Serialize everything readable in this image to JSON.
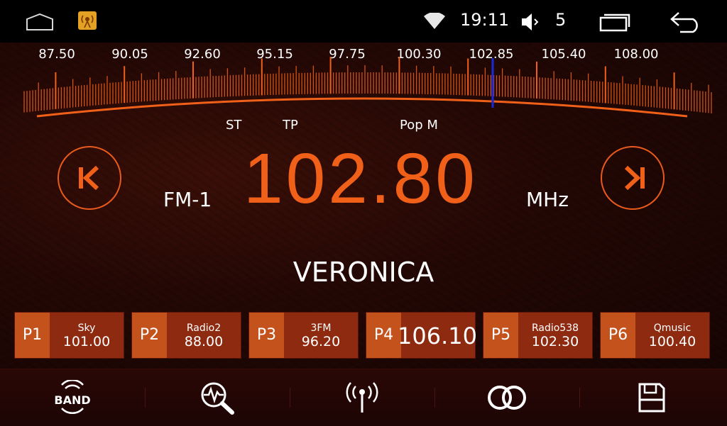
{
  "status_bar": {
    "time": "19:11",
    "volume_level": "5",
    "icons": [
      "home-icon",
      "radio-app-icon",
      "wifi-icon",
      "speaker-icon",
      "recent-apps-icon",
      "back-icon"
    ]
  },
  "dial": {
    "scale": [
      "87.50",
      "90.05",
      "92.60",
      "95.15",
      "97.75",
      "100.30",
      "102.85",
      "105.40",
      "108.00"
    ],
    "accent_color": "#f06018",
    "needle_color": "#1a2ad8"
  },
  "indicators": {
    "st": "ST",
    "tp": "TP",
    "pty": "Pop M"
  },
  "tuner": {
    "band": "FM-1",
    "frequency": "102.80",
    "unit": "MHz",
    "station_name": "VERONICA",
    "prev_icon": "seek-back-icon",
    "next_icon": "seek-forward-icon"
  },
  "presets": [
    {
      "num": "P1",
      "name": "Sky",
      "freq": "101.00"
    },
    {
      "num": "P2",
      "name": "Radio2",
      "freq": "88.00"
    },
    {
      "num": "P3",
      "name": "3FM",
      "freq": "96.20"
    },
    {
      "num": "P4",
      "name": "",
      "freq": "106.10"
    },
    {
      "num": "P5",
      "name": "Radio538",
      "freq": "102.30"
    },
    {
      "num": "P6",
      "name": "Qmusic",
      "freq": "100.40"
    }
  ],
  "toolbar": {
    "band_label": "BAND",
    "icons": [
      "band-icon",
      "scan-search-icon",
      "antenna-icon",
      "stereo-icon",
      "save-icon"
    ]
  }
}
